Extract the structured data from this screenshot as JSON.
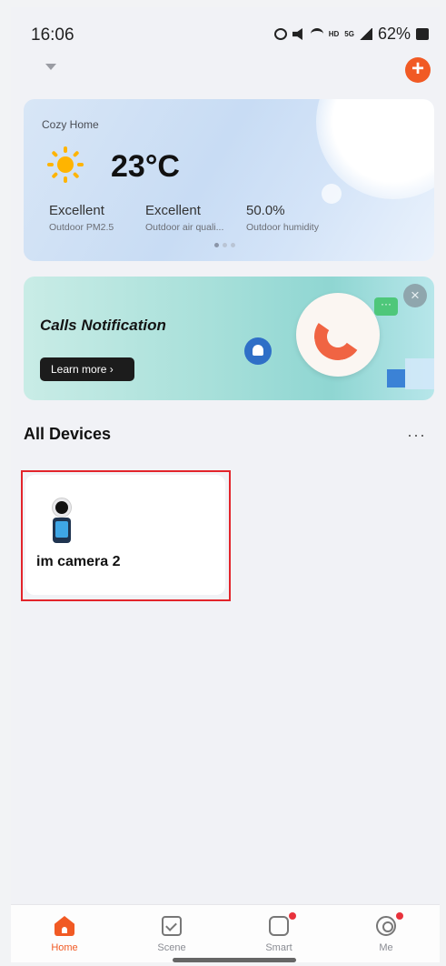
{
  "status_bar": {
    "time": "16:06",
    "network_hd": "HD",
    "network_gen": "5G",
    "battery": "62%"
  },
  "weather": {
    "home_name": "Cozy Home",
    "icon": "sun-icon",
    "temperature": "23°C",
    "metrics": [
      {
        "value": "Excellent",
        "label": "Outdoor PM2.5"
      },
      {
        "value": "Excellent",
        "label": "Outdoor air quali..."
      },
      {
        "value": "50.0%",
        "label": "Outdoor humidity"
      }
    ]
  },
  "banner": {
    "title": "Calls Notification",
    "button_label": "Learn more ›",
    "chat_glyph": "···",
    "close_glyph": "×"
  },
  "devices": {
    "section_title": "All Devices",
    "more_glyph": "···",
    "items": [
      {
        "name": "im camera 2",
        "icon": "camera-icon"
      }
    ]
  },
  "tab_bar": {
    "tabs": [
      {
        "label": "Home",
        "active": true
      },
      {
        "label": "Scene",
        "active": false
      },
      {
        "label": "Smart",
        "active": false
      },
      {
        "label": "Me",
        "active": false
      }
    ]
  },
  "colors": {
    "accent": "#f15a24",
    "highlight": "#e3242b"
  }
}
